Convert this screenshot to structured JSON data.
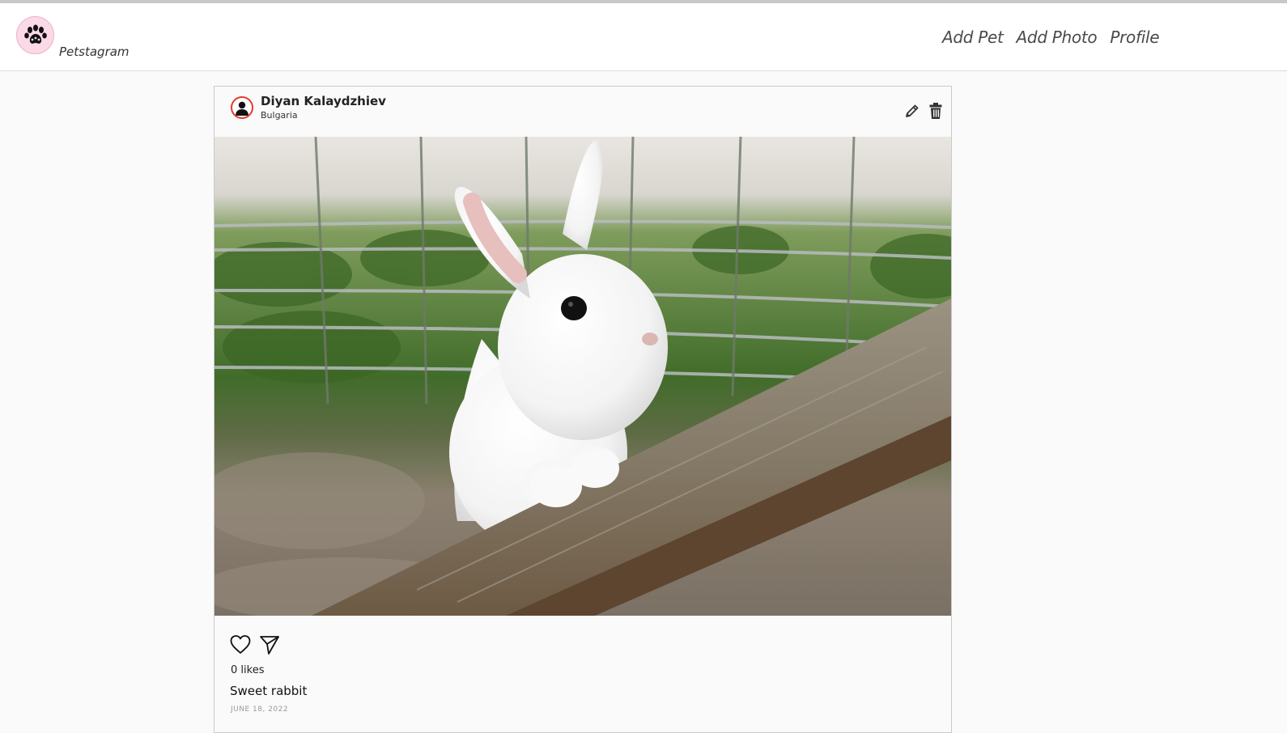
{
  "navbar": {
    "brand": "Petstagram",
    "links": [
      "Add Pet",
      "Add Photo",
      "Profile"
    ]
  },
  "post": {
    "username": "Diyan Kalaydzhiev",
    "location": "Bulgaria",
    "image_alt": "rabbit-photo",
    "likes": "0 likes",
    "caption": "Sweet rabbit",
    "date": "JUNE 18, 2022"
  },
  "icons": {
    "logo": "paw-icon",
    "avatar": "user-icon",
    "edit": "pencil-icon",
    "delete": "trash-icon",
    "like": "heart-icon",
    "share": "send-icon"
  },
  "colors": {
    "logo_bg": "#fcd9e6",
    "avatar_ring": "#e23b2e",
    "page_bg": "#fafafa"
  }
}
